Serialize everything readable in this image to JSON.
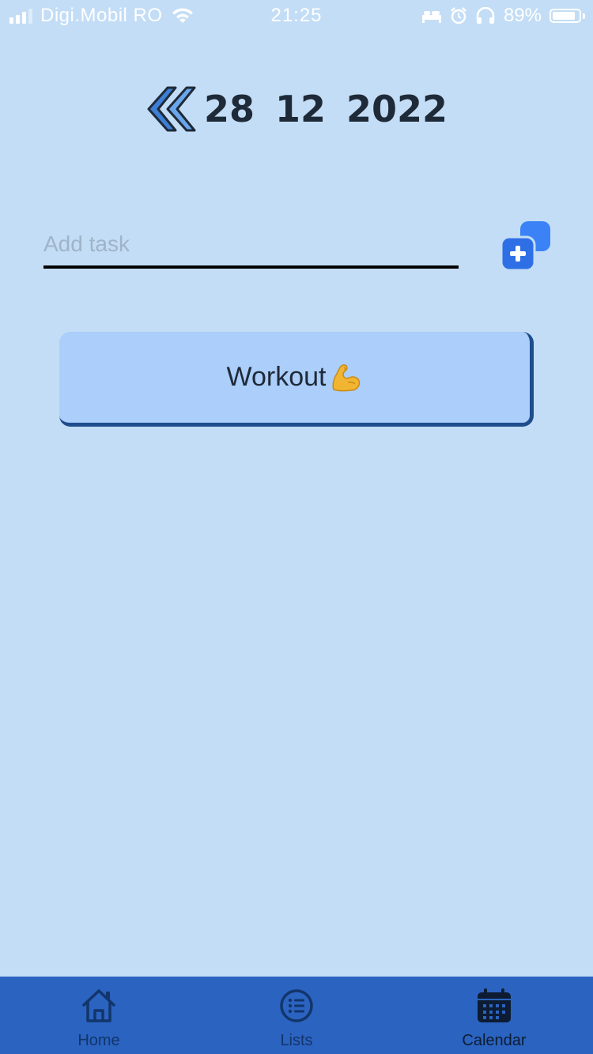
{
  "status_bar": {
    "carrier": "Digi.Mobil RO",
    "time": "21:25",
    "battery_percent": "89%",
    "battery_level": 0.89,
    "icons": [
      "signal-icon",
      "wifi-icon",
      "bed-icon",
      "alarm-icon",
      "headphones-icon",
      "battery-icon"
    ]
  },
  "header": {
    "day": "28",
    "month": "12",
    "year": "2022",
    "back_icon": "double-chevron-left-icon"
  },
  "task_entry": {
    "placeholder": "Add task",
    "value": "",
    "add_icon": "add-task-icon"
  },
  "tasks": [
    {
      "label": "Workout",
      "emoji": "flexed-biceps"
    }
  ],
  "tab_bar": {
    "tabs": [
      {
        "label": "Home",
        "icon": "home-icon",
        "active": false
      },
      {
        "label": "Lists",
        "icon": "list-icon",
        "active": false
      },
      {
        "label": "Calendar",
        "icon": "calendar-icon",
        "active": true
      }
    ]
  },
  "colors": {
    "background": "#c3ddf6",
    "card": "#abcefa",
    "card_shadow": "#1e4d8c",
    "tab_bar": "#2b63c0",
    "accent_blue": "#3b82f6"
  }
}
